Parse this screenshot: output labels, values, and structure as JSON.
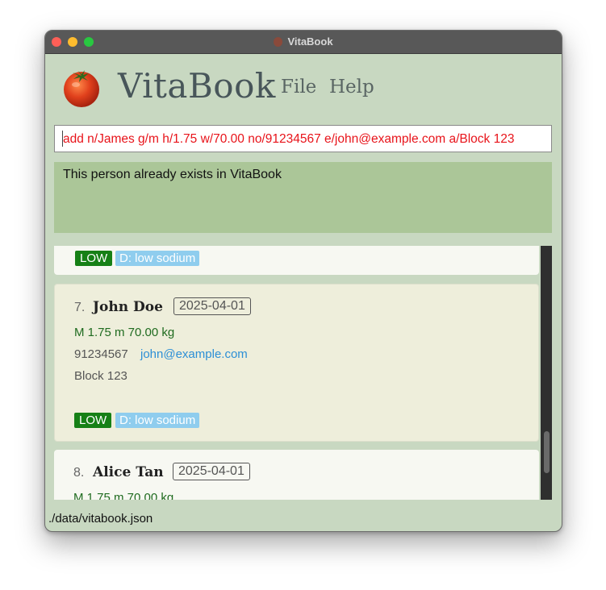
{
  "window": {
    "title": "VitaBook"
  },
  "header": {
    "app_name": "VitaBook",
    "menu": [
      "File",
      "Help"
    ]
  },
  "command": {
    "value": "add n/James g/m h/1.75 w/70.00 no/91234567 e/john@example.com a/Block 123"
  },
  "result": {
    "message": "This person already exists in VitaBook"
  },
  "persons": [
    {
      "index": "",
      "name": "",
      "date": "",
      "stats": "",
      "phone": "",
      "email": "",
      "address": "",
      "tags": {
        "priority": "LOW",
        "diet": "D: low sodium"
      }
    },
    {
      "index": "7.",
      "name": "John Doe",
      "date": "2025-04-01",
      "stats": "M  1.75 m  70.00 kg",
      "phone": "91234567",
      "email": "john@example.com",
      "address": "Block 123",
      "tags": {
        "priority": "LOW",
        "diet": "D: low sodium"
      }
    },
    {
      "index": "8.",
      "name": "Alice Tan",
      "date": "2025-04-01",
      "stats": "M  1.75 m  70.00 kg",
      "phone": "",
      "email": "",
      "address": "",
      "tags": {
        "priority": "",
        "diet": ""
      }
    }
  ],
  "status_bar": {
    "file_path": "./data/vitabook.json"
  },
  "colors": {
    "background": "#c8d8c1",
    "result_box": "#abc698",
    "command_text": "#e8131a",
    "tag_priority": "#168016",
    "tag_diet": "#8fcdee",
    "email": "#2c8fd6"
  },
  "icons": {
    "logo": "tomato-logo"
  }
}
